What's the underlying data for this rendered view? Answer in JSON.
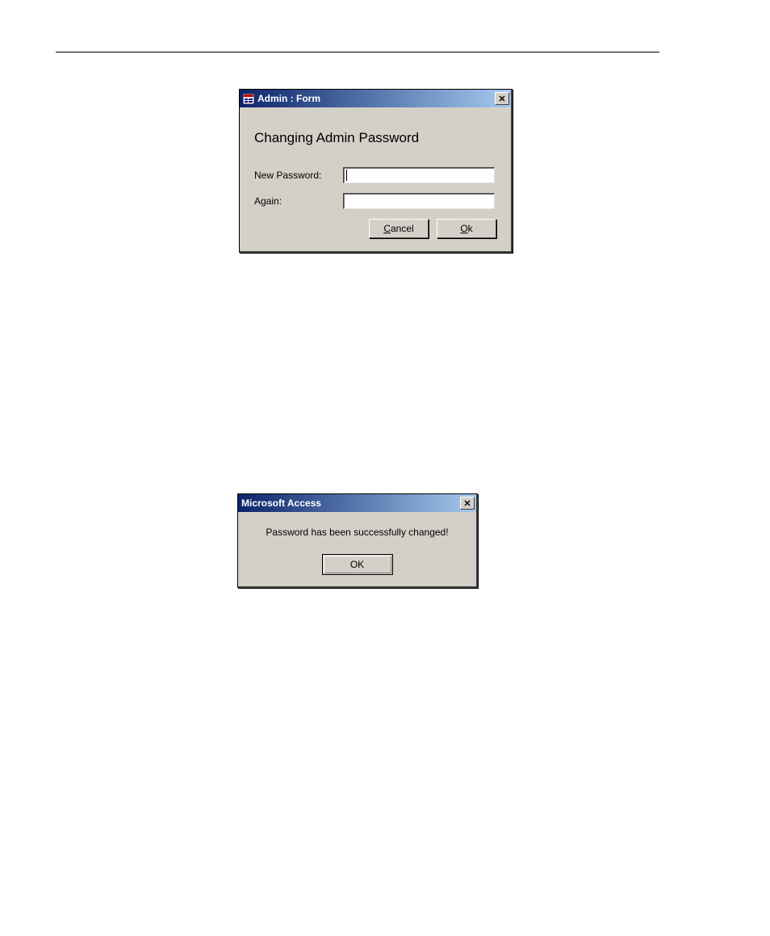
{
  "dialog1": {
    "title": "Admin : Form",
    "heading": "Changing Admin Password",
    "fields": {
      "new_password": {
        "label": "New Password:",
        "value": ""
      },
      "again": {
        "label": "Again:",
        "value": ""
      }
    },
    "buttons": {
      "cancel": {
        "label_pre": "",
        "accel": "C",
        "label_post": "ancel"
      },
      "ok": {
        "label_pre": "",
        "accel": "O",
        "label_post": "k"
      }
    },
    "close_symbol": "✕"
  },
  "dialog2": {
    "title": "Microsoft Access",
    "message": "Password has been successfully changed!",
    "ok_label": "OK",
    "close_symbol": "✕"
  }
}
